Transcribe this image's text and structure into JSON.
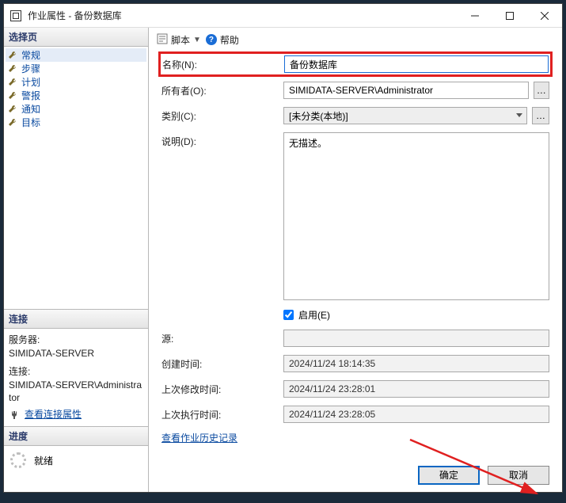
{
  "window": {
    "title": "作业属性 - 备份数据库"
  },
  "sidebar": {
    "select_header": "选择页",
    "items": [
      "常规",
      "步骤",
      "计划",
      "警报",
      "通知",
      "目标"
    ],
    "conn_header": "连接",
    "conn": {
      "server_label": "服务器:",
      "server_value": "SIMIDATA-SERVER",
      "conn_label": "连接:",
      "conn_value": "SIMIDATA-SERVER\\Administrator",
      "view_props": "查看连接属性"
    },
    "progress_header": "进度",
    "progress_status": "就绪"
  },
  "toolbar": {
    "script": "脚本",
    "help": "帮助"
  },
  "form": {
    "name_label": "名称(N):",
    "name_value": "备份数据库",
    "owner_label": "所有者(O):",
    "owner_value": "SIMIDATA-SERVER\\Administrator",
    "owner_btn": "…",
    "category_label": "类别(C):",
    "category_value": "[未分类(本地)]",
    "category_btn": "…",
    "desc_label": "说明(D):",
    "desc_value": "无描述。",
    "enabled_label": "启用(E)",
    "source_label": "源:",
    "source_value": "",
    "created_label": "创建时间:",
    "created_value": "2024/11/24 18:14:35",
    "modified_label": "上次修改时间:",
    "modified_value": "2024/11/24 23:28:01",
    "lastrun_label": "上次执行时间:",
    "lastrun_value": "2024/11/24 23:28:05",
    "history_link": "查看作业历史记录"
  },
  "buttons": {
    "ok": "确定",
    "cancel": "取消"
  }
}
